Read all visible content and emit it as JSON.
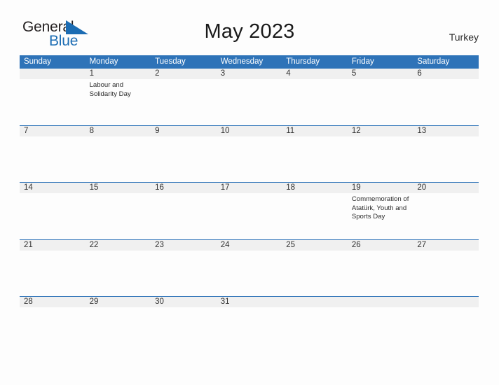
{
  "header": {
    "logo": {
      "text_primary": "General",
      "text_secondary": "Blue",
      "flag_icon": "blue-triangle-flag-icon",
      "primary_color": "#231f20",
      "secondary_color": "#1b6cb3"
    },
    "title": "May 2023",
    "region": "Turkey"
  },
  "theme": {
    "header_bar_color": "#2e73b8",
    "row_band_color": "#f0f0f0",
    "row_divider_color": "#2e73b8",
    "page_background": "#fdfdfd",
    "day_number_color": "#333333",
    "event_text_color": "#2b2b2b"
  },
  "calendar": {
    "month": "May",
    "year": "2023",
    "weekday_headers": [
      "Sunday",
      "Monday",
      "Tuesday",
      "Wednesday",
      "Thursday",
      "Friday",
      "Saturday"
    ],
    "weeks": [
      [
        {
          "day": "",
          "events": []
        },
        {
          "day": "1",
          "events": [
            "Labour and Solidarity Day"
          ]
        },
        {
          "day": "2",
          "events": []
        },
        {
          "day": "3",
          "events": []
        },
        {
          "day": "4",
          "events": []
        },
        {
          "day": "5",
          "events": []
        },
        {
          "day": "6",
          "events": []
        }
      ],
      [
        {
          "day": "7",
          "events": []
        },
        {
          "day": "8",
          "events": []
        },
        {
          "day": "9",
          "events": []
        },
        {
          "day": "10",
          "events": []
        },
        {
          "day": "11",
          "events": []
        },
        {
          "day": "12",
          "events": []
        },
        {
          "day": "13",
          "events": []
        }
      ],
      [
        {
          "day": "14",
          "events": []
        },
        {
          "day": "15",
          "events": []
        },
        {
          "day": "16",
          "events": []
        },
        {
          "day": "17",
          "events": []
        },
        {
          "day": "18",
          "events": []
        },
        {
          "day": "19",
          "events": [
            "Commemoration of Atatürk, Youth and Sports Day"
          ]
        },
        {
          "day": "20",
          "events": []
        }
      ],
      [
        {
          "day": "21",
          "events": []
        },
        {
          "day": "22",
          "events": []
        },
        {
          "day": "23",
          "events": []
        },
        {
          "day": "24",
          "events": []
        },
        {
          "day": "25",
          "events": []
        },
        {
          "day": "26",
          "events": []
        },
        {
          "day": "27",
          "events": []
        }
      ],
      [
        {
          "day": "28",
          "events": []
        },
        {
          "day": "29",
          "events": []
        },
        {
          "day": "30",
          "events": []
        },
        {
          "day": "31",
          "events": []
        },
        {
          "day": "",
          "events": []
        },
        {
          "day": "",
          "events": []
        },
        {
          "day": "",
          "events": []
        }
      ]
    ]
  }
}
